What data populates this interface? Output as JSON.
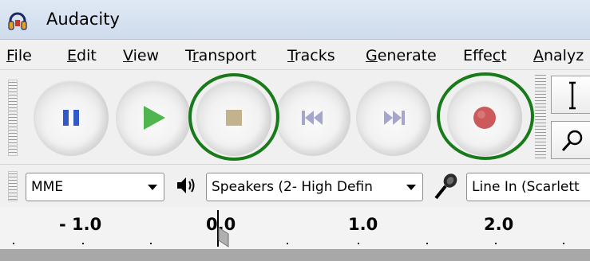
{
  "window": {
    "title": "Audacity",
    "icon": "headphones-icon"
  },
  "menu": {
    "items": [
      {
        "underline": "F",
        "rest": "ile"
      },
      {
        "underline": "E",
        "rest": "dit"
      },
      {
        "underline": "V",
        "rest": "iew"
      },
      {
        "pre": "T",
        "underline": "r",
        "rest": "ansport"
      },
      {
        "underline": "T",
        "rest": "racks"
      },
      {
        "underline": "G",
        "rest": "enerate"
      },
      {
        "pre": "Effe",
        "underline": "c",
        "rest": "t"
      },
      {
        "underline": "A",
        "rest": "nalyz"
      }
    ]
  },
  "transport": {
    "buttons": [
      "pause-icon",
      "play-icon",
      "stop-icon",
      "skip-to-start-icon",
      "skip-to-end-icon",
      "record-icon"
    ],
    "highlighted": [
      "stop",
      "record"
    ],
    "colors": {
      "pause": "#3358c8",
      "play": "#4fb54f",
      "stop": "#c2b38d",
      "skip": "#a6a6cc",
      "record": "#cc5a5a",
      "highlight": "#197a19"
    }
  },
  "tools": [
    "selection-tool-icon",
    "zoom-tool-icon"
  ],
  "device": {
    "host": "MME",
    "output_icon": "speaker-icon",
    "output": "Speakers (2- High Defin",
    "input_icon": "microphone-icon",
    "input": "Line In (Scarlett"
  },
  "ruler": {
    "labels": [
      "- 1.0",
      "0.0",
      "1.0",
      "2.0"
    ]
  }
}
